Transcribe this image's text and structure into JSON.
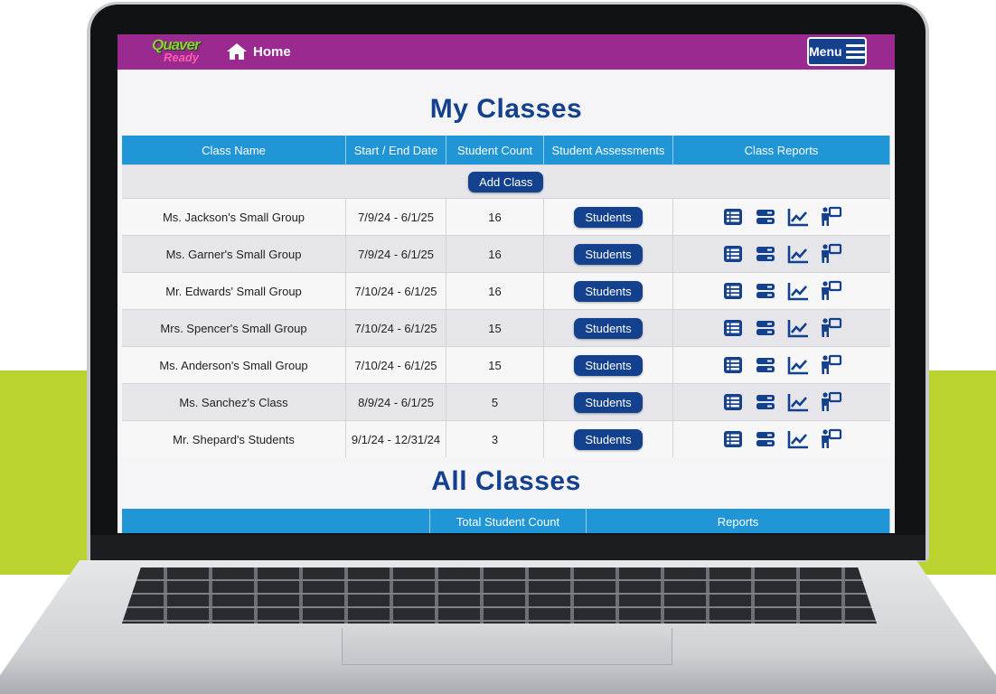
{
  "brand": {
    "logo_line1": "Quaver",
    "logo_line2": "Ready"
  },
  "nav": {
    "home_label": "Home",
    "menu_label": "Menu"
  },
  "my_classes": {
    "title": "My Classes",
    "columns": [
      "Class Name",
      "Start / End Date",
      "Student Count",
      "Student Assessments",
      "Class Reports"
    ],
    "add_class_label": "Add Class",
    "students_button_label": "Students",
    "rows": [
      {
        "name": "Ms. Jackson's Small Group",
        "dates": "7/9/24 - 6/1/25",
        "count": "16"
      },
      {
        "name": "Ms. Garner's Small Group",
        "dates": "7/9/24 - 6/1/25",
        "count": "16"
      },
      {
        "name": "Mr. Edwards' Small Group",
        "dates": "7/10/24 - 6/1/25",
        "count": "16"
      },
      {
        "name": "Mrs. Spencer's Small Group",
        "dates": "7/10/24 - 6/1/25",
        "count": "15"
      },
      {
        "name": "Ms. Anderson's Small Group",
        "dates": "7/10/24 - 6/1/25",
        "count": "15"
      },
      {
        "name": "Ms. Sanchez's Class",
        "dates": "8/9/24 - 6/1/25",
        "count": "5"
      },
      {
        "name": "Mr. Shepard's Students",
        "dates": "9/1/24 - 12/31/24",
        "count": "3"
      }
    ],
    "report_icons": [
      "list-report-icon",
      "summary-report-icon",
      "chart-report-icon",
      "teacher-report-icon"
    ]
  },
  "all_classes": {
    "title": "All Classes",
    "columns": [
      "",
      "Total Student Count",
      "Reports"
    ]
  },
  "colors": {
    "topbar": "#9a2a8f",
    "header_blue": "#2096d6",
    "navy": "#13418e",
    "lime_band": "#bcd22e"
  }
}
